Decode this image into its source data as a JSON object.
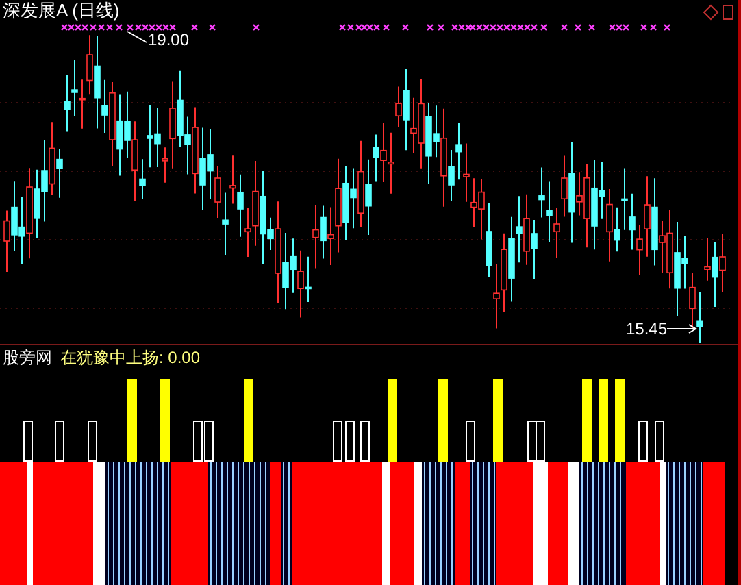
{
  "chart_title": "深发展A (日线)",
  "high_label": "19.00",
  "low_label": "15.45",
  "indicator": {
    "source": "股旁网",
    "label": "在犹豫中上扬: 0.00"
  }
}
